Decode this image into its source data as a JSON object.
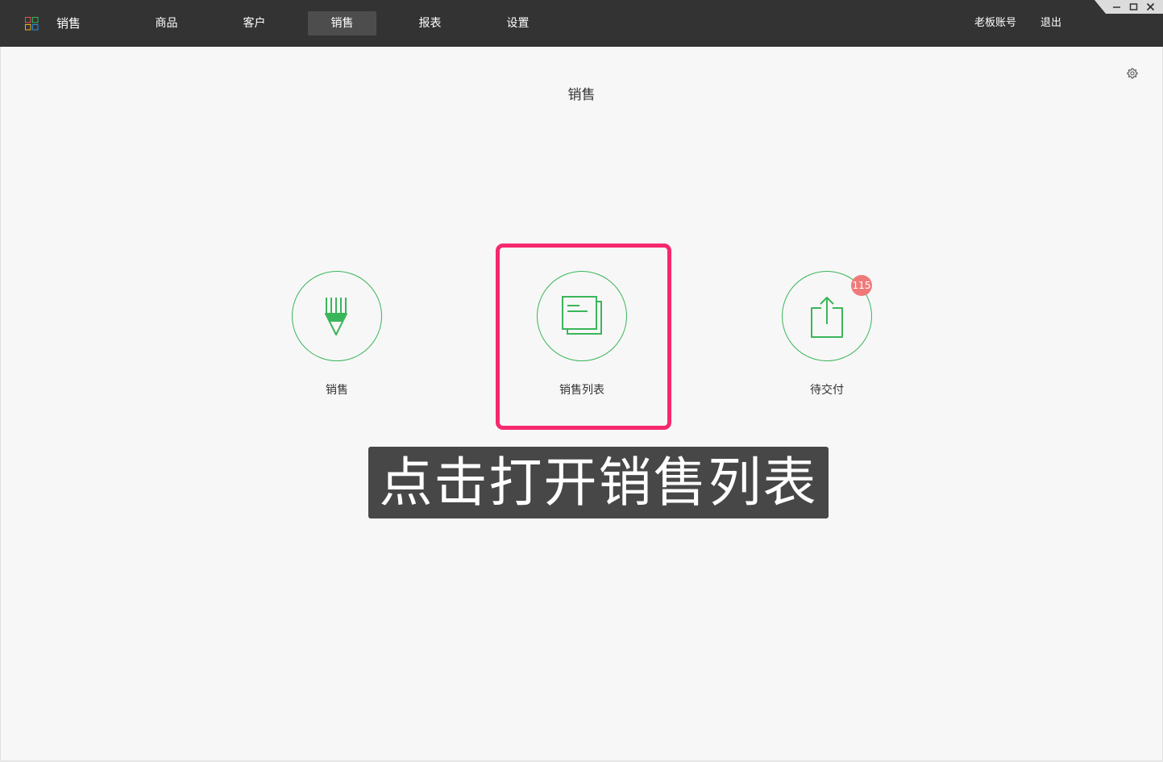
{
  "app": {
    "title": "销售"
  },
  "nav": {
    "items": [
      {
        "label": "商品"
      },
      {
        "label": "客户"
      },
      {
        "label": "销售"
      },
      {
        "label": "报表"
      },
      {
        "label": "设置"
      }
    ],
    "active_label": "销售"
  },
  "header_right": {
    "account_label": "老板账号",
    "logout_label": "退出"
  },
  "window_controls": [
    "minimize-icon",
    "maximize-icon",
    "close-icon"
  ],
  "page": {
    "title": "销售",
    "settings_icon": "gear-icon"
  },
  "tiles": [
    {
      "label": "销售",
      "icon": "pencil-icon"
    },
    {
      "label": "销售列表",
      "icon": "document-list-icon"
    },
    {
      "label": "待交付",
      "icon": "share-upload-icon",
      "badge": "115"
    }
  ],
  "caption": {
    "text": "点击打开销售列表"
  },
  "colors": {
    "topbar": "#333333",
    "nav_active": "#4d4d4d",
    "accent_green": "#3bb55a",
    "highlight": "#f5296d",
    "badge": "#f07a7a"
  }
}
